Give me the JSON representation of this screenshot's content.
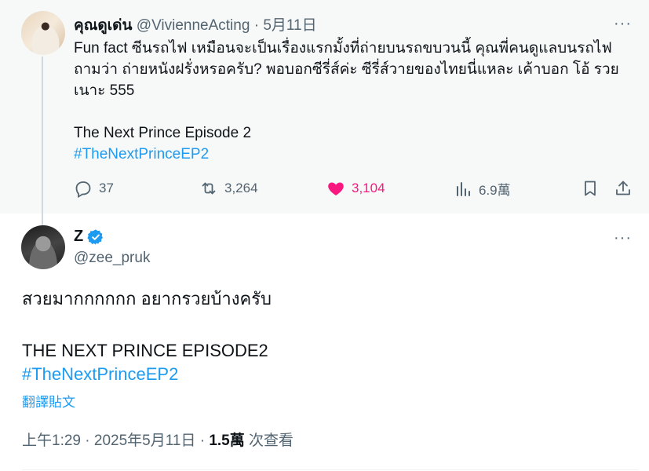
{
  "parent": {
    "display_name": "คุณดูเด่น",
    "handle": "@VivienneActing",
    "separator": "·",
    "date": "5月11日",
    "more_label": "···",
    "text_lines": [
      "Fun fact ซีนรถไฟ เหมือนจะเป็นเรื่องแรกมั้งที่ถ่ายบนรถขบวนนี้ คุณพี่คนดูแลบนรถไฟ",
      "ถามว่า ถ่ายหนังฝรั่งหรอครับ? พอบอกซีรี่ส์ค่ะ ซีรี่ส์วายของไทยนี่แหละ เค้าบอก โอ้ รวย",
      "เนาะ 555"
    ],
    "title_line": "The Next Prince Episode 2",
    "hashtag": "#TheNextPrinceEP2",
    "actions": {
      "replies": "37",
      "retweets": "3,264",
      "likes": "3,104",
      "views": "6.9萬"
    }
  },
  "main": {
    "display_name": "Z",
    "handle": "@zee_pruk",
    "more_label": "···",
    "text_line1": "สวยมากกกกกก อยากรวยบ้างครับ",
    "text_line2": "THE NEXT PRINCE EPISODE2",
    "hashtag": "#TheNextPrinceEP2",
    "translate_label": "翻譯貼文",
    "time": "上午1:29",
    "separator": "·",
    "date": "2025年5月11日",
    "views_count": "1.5萬",
    "views_label": "次查看"
  },
  "colors": {
    "accent": "#1d9bf0",
    "like": "#f91880",
    "muted": "#536471",
    "verified": "#1d9bf0"
  },
  "icons": [
    "reply-icon",
    "retweet-icon",
    "heart-icon",
    "views-icon",
    "bookmark-icon",
    "share-icon",
    "verified-badge-icon",
    "more-icon"
  ]
}
